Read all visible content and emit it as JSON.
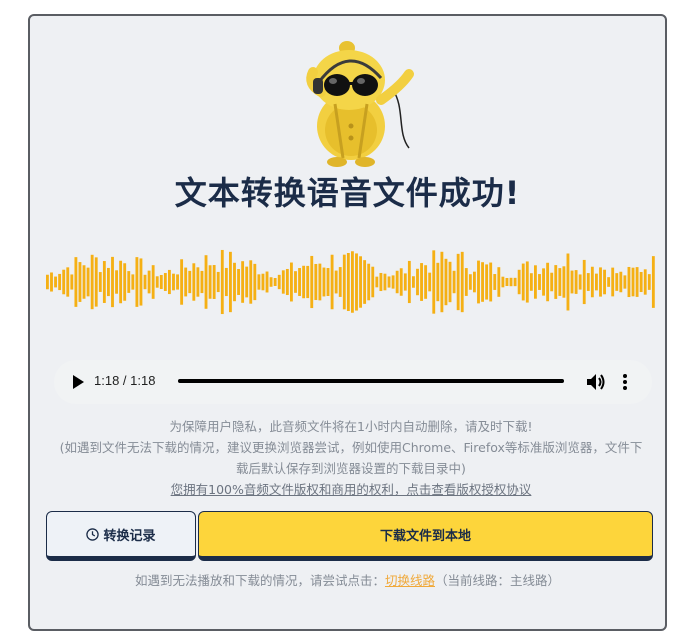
{
  "header": {
    "title": "文本转换语音文件成功!"
  },
  "player": {
    "current_time": "1:18",
    "separator": " / ",
    "duration": "1:18",
    "progress": 1.0,
    "play_icon": "play-icon",
    "volume_icon": "volume-icon",
    "more_icon": "more-options-icon"
  },
  "notice": {
    "line1": "为保障用户隐私，此音频文件将在1小时内自动删除，请及时下载!",
    "line2": "(如遇到文件无法下载的情况，建议更换浏览器尝试，例如使用Chrome、Firefox等标准版浏览器，文件下载后默认保存到浏览器设置的下载目录中)",
    "license_link": "您拥有100%音频文件版权和商用的权利，点击查看版权授权协议"
  },
  "actions": {
    "history_label": "转换记录",
    "history_icon": "clock-icon",
    "download_label": "下载文件到本地"
  },
  "footer": {
    "prefix": "如遇到无法播放和下载的情况，请尝试点击：",
    "switch_link": "切换线路",
    "suffix": "（当前线路：主线路）"
  },
  "colors": {
    "accent": "#fdd53b",
    "navy": "#1b2c48",
    "wave": "#f5b014",
    "link_orange": "#f0a93a"
  }
}
